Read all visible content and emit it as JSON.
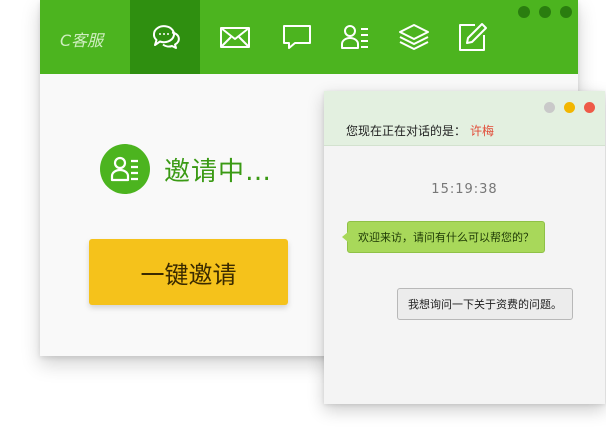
{
  "main": {
    "logo": "C客服",
    "tabs": [
      {
        "icon": "chat-bubbles-icon",
        "active": true
      },
      {
        "icon": "mail-icon",
        "active": false
      },
      {
        "icon": "message-icon",
        "active": false
      },
      {
        "icon": "contact-list-icon",
        "active": false
      },
      {
        "icon": "layers-icon",
        "active": false
      },
      {
        "icon": "edit-icon",
        "active": false
      }
    ],
    "invite_status": "邀请中…",
    "invite_button": "一键邀请"
  },
  "chat": {
    "title_prefix": "您现在正在对话的是：",
    "contact_name": "许梅",
    "timestamp": "15:19:38",
    "messages": [
      {
        "from": "agent",
        "text": "欢迎来访，请问有什么可以帮您的？"
      },
      {
        "from": "visitor",
        "text": "我想询问一下关于资费的问题。"
      }
    ]
  },
  "colors": {
    "toolbar": "#4cb41f",
    "toolbar_active": "#2f8f10",
    "accent_text": "#3a9a14",
    "button": "#f5c21b",
    "contact_name": "#e24a36",
    "bubble_agent": "#a8d85a"
  }
}
